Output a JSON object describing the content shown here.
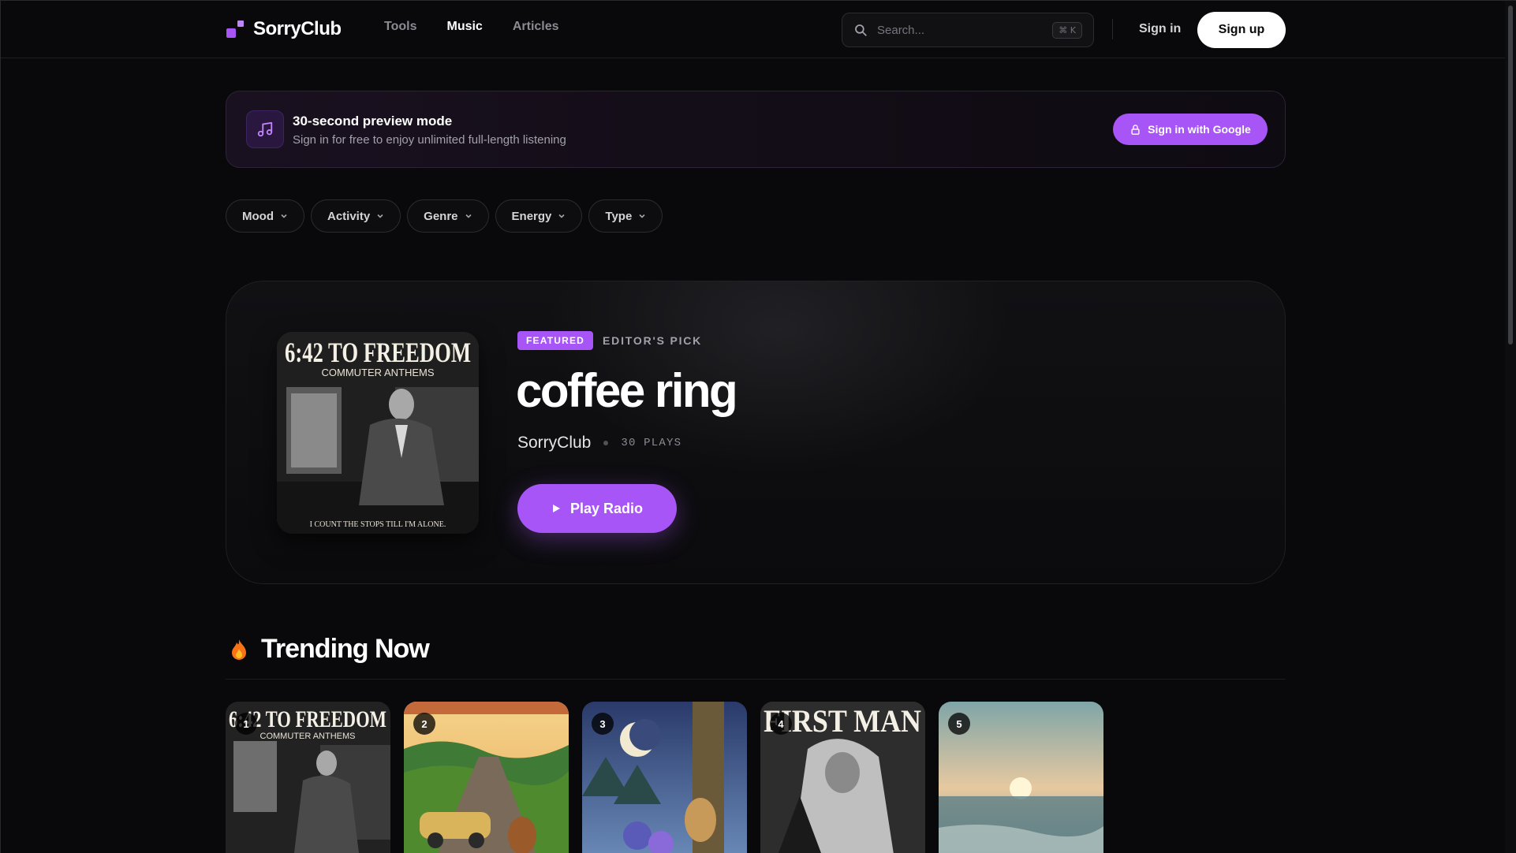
{
  "brand": {
    "name": "SorryClub"
  },
  "nav": {
    "links": [
      {
        "label": "Tools",
        "active": false
      },
      {
        "label": "Music",
        "active": true
      },
      {
        "label": "Articles",
        "active": false
      }
    ]
  },
  "search": {
    "placeholder": "Search...",
    "shortcut": "⌘ K"
  },
  "auth": {
    "signin_label": "Sign in",
    "signup_label": "Sign up"
  },
  "banner": {
    "title": "30-second preview mode",
    "subtitle": "Sign in for free to enjoy unlimited full-length listening",
    "button_label": "Sign in with Google"
  },
  "filters": [
    {
      "label": "Mood"
    },
    {
      "label": "Activity"
    },
    {
      "label": "Genre"
    },
    {
      "label": "Energy"
    },
    {
      "label": "Type"
    }
  ],
  "featured": {
    "badge": "FEATURED",
    "tag": "EDITOR'S PICK",
    "title": "coffee ring",
    "artist": "SorryClub",
    "plays": "30 PLAYS",
    "play_label": "Play Radio",
    "cover": {
      "headline": "6:42 TO FREEDOM",
      "subtitle": "COMMUTER ANTHEMS",
      "footer": "I COUNT THE STOPS TILL I'M ALONE."
    }
  },
  "trending": {
    "title": "Trending Now",
    "cards": [
      {
        "rank": "1",
        "headline": "6:42 TO FREEDOM",
        "subtitle": "COMMUTER ANTHEMS"
      },
      {
        "rank": "2"
      },
      {
        "rank": "3"
      },
      {
        "rank": "4",
        "headline": "FIRST MAN"
      },
      {
        "rank": "5"
      }
    ]
  },
  "colors": {
    "accent": "#a855f7",
    "background": "#09090b",
    "text": "#fafafa",
    "muted": "#a1a1aa"
  }
}
